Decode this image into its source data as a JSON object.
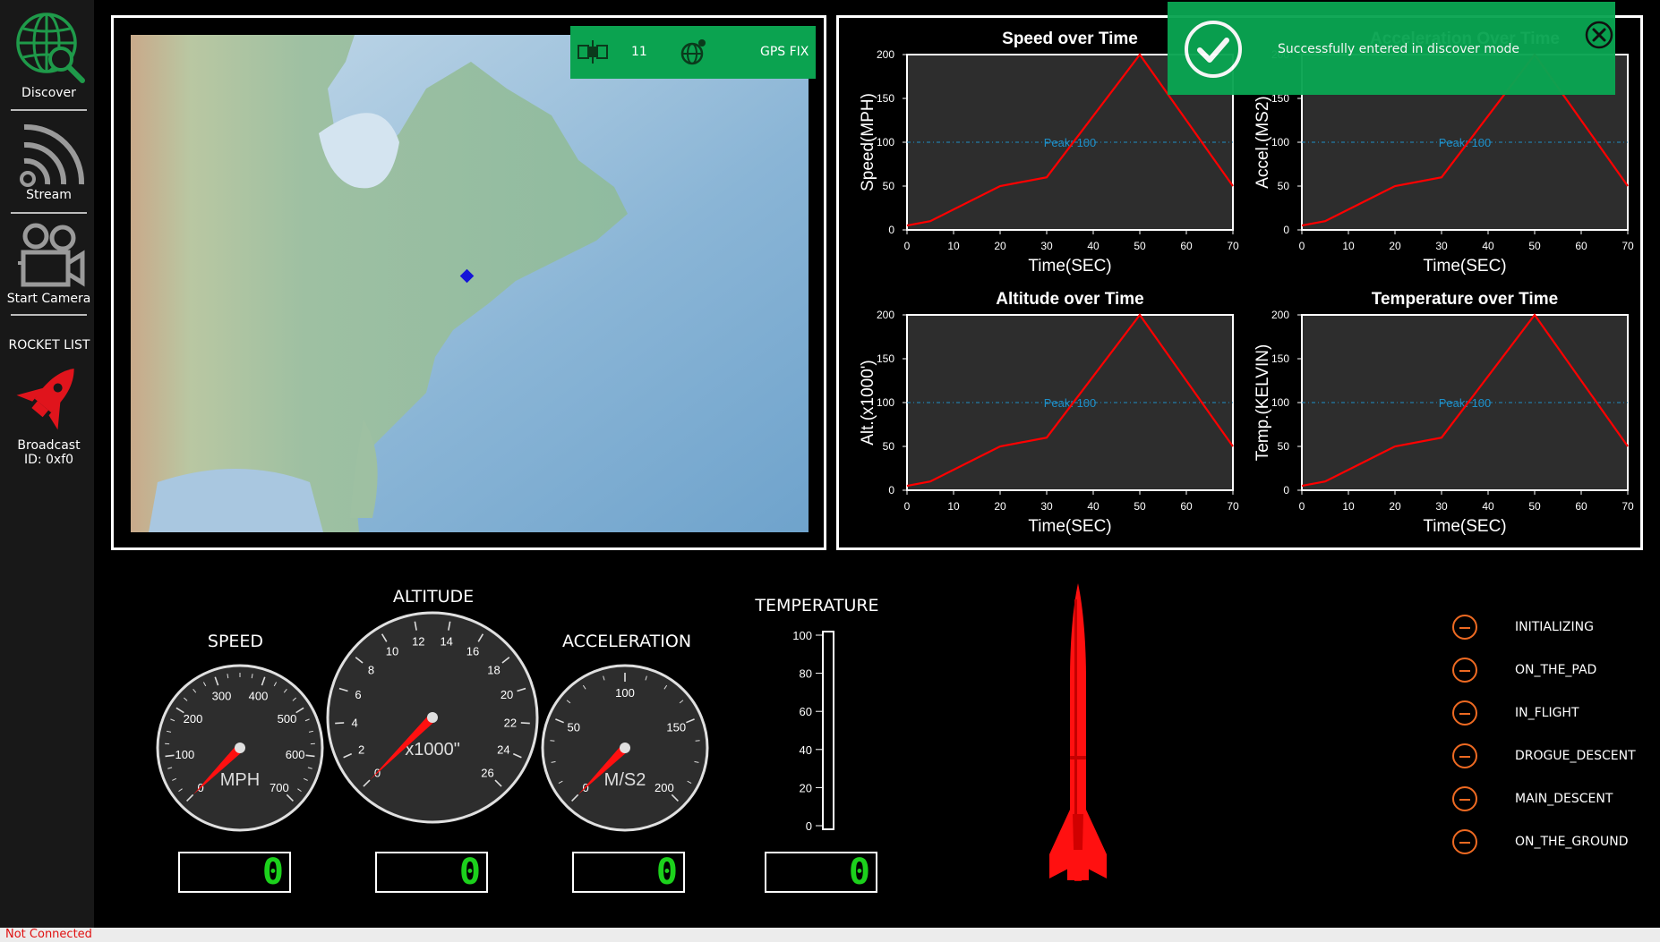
{
  "sidebar": {
    "discover_label": "Discover",
    "stream_label": "Stream",
    "camera_label": "Start Camera",
    "rocket_list_title": "ROCKET LIST",
    "rocket_item_label": "Broadcast",
    "rocket_item_id": "ID: 0xf0",
    "icons": [
      "globe-search-icon",
      "wifi-stream-icon",
      "camera-icon",
      "rocket-icon"
    ]
  },
  "gps": {
    "satellite_count": "11",
    "fix_label": "GPS FIX",
    "icons": [
      "satellite-icon",
      "gps-globe-icon"
    ]
  },
  "toast": {
    "message": "Successfully entered in discover mode",
    "color": "#0aa552",
    "icons": [
      "check-circle-icon",
      "close-circle-icon"
    ]
  },
  "chart_data": [
    {
      "type": "line",
      "title": "Speed over Time",
      "xlabel": "Time(SEC)",
      "ylabel": "Speed(MPH)",
      "x": [
        0,
        5,
        20,
        30,
        50,
        70
      ],
      "series": [
        {
          "values": [
            5,
            10,
            50,
            60,
            200,
            50
          ],
          "color": "#ff0000"
        }
      ],
      "reference_line": {
        "value": 100,
        "label": "Peak: 100",
        "color": "#1e8fc8"
      },
      "xlim": [
        0,
        70
      ],
      "ylim": [
        0,
        200
      ],
      "xticks": [
        "0",
        "10",
        "20",
        "30",
        "40",
        "50",
        "60",
        "70"
      ],
      "yticks": [
        "0",
        "50",
        "100",
        "150",
        "200"
      ],
      "background": "#2d2d2d"
    },
    {
      "type": "line",
      "title": "Acceleration Over Time",
      "xlabel": "Time(SEC)",
      "ylabel": "Accel.(MS2)",
      "x": [
        0,
        5,
        20,
        30,
        50,
        70
      ],
      "series": [
        {
          "values": [
            5,
            10,
            50,
            60,
            200,
            50
          ],
          "color": "#ff0000"
        }
      ],
      "reference_line": {
        "value": 100,
        "label": "Peak: 100",
        "color": "#1e8fc8"
      },
      "xlim": [
        0,
        70
      ],
      "ylim": [
        0,
        200
      ],
      "xticks": [
        "0",
        "10",
        "20",
        "30",
        "40",
        "50",
        "60",
        "70"
      ],
      "yticks": [
        "0",
        "50",
        "100",
        "150",
        "200"
      ],
      "background": "#2d2d2d"
    },
    {
      "type": "line",
      "title": "Altitude over Time",
      "xlabel": "Time(SEC)",
      "ylabel": "Alt.(x1000')",
      "x": [
        0,
        5,
        20,
        30,
        50,
        70
      ],
      "series": [
        {
          "values": [
            5,
            10,
            50,
            60,
            200,
            50
          ],
          "color": "#ff0000"
        }
      ],
      "reference_line": {
        "value": 100,
        "label": "Peak: 100",
        "color": "#1e8fc8"
      },
      "xlim": [
        0,
        70
      ],
      "ylim": [
        0,
        200
      ],
      "xticks": [
        "0",
        "10",
        "20",
        "30",
        "40",
        "50",
        "60",
        "70"
      ],
      "yticks": [
        "0",
        "50",
        "100",
        "150",
        "200"
      ],
      "background": "#2d2d2d"
    },
    {
      "type": "line",
      "title": "Temperature over Time",
      "xlabel": "Time(SEC)",
      "ylabel": "Temp.(KELVIN)",
      "x": [
        0,
        5,
        20,
        30,
        50,
        70
      ],
      "series": [
        {
          "values": [
            5,
            10,
            50,
            60,
            200,
            50
          ],
          "color": "#ff0000"
        }
      ],
      "reference_line": {
        "value": 100,
        "label": "Peak: 100",
        "color": "#1e8fc8"
      },
      "xlim": [
        0,
        70
      ],
      "ylim": [
        0,
        200
      ],
      "xticks": [
        "0",
        "10",
        "20",
        "30",
        "40",
        "50",
        "60",
        "70"
      ],
      "yticks": [
        "0",
        "50",
        "100",
        "150",
        "200"
      ],
      "background": "#2d2d2d"
    }
  ],
  "gauges": [
    {
      "id": "speed",
      "title": "SPEED",
      "unit": "MPH",
      "ticks": [
        "0",
        "100",
        "200",
        "300",
        "400",
        "500",
        "600",
        "700"
      ],
      "value": 0,
      "display": "0"
    },
    {
      "id": "altitude",
      "title": "ALTITUDE",
      "unit": "x1000\"",
      "ticks": [
        "0",
        "2",
        "4",
        "6",
        "8",
        "10",
        "12",
        "14",
        "16",
        "18",
        "20",
        "22",
        "24",
        "26"
      ],
      "value": 0,
      "display": "0"
    },
    {
      "id": "acceleration",
      "title": "ACCELERATION",
      "unit": "M/S2",
      "ticks": [
        "0",
        "50",
        "100",
        "150",
        "200"
      ],
      "value": 0,
      "display": "0"
    }
  ],
  "temperature": {
    "title": "TEMPERATURE",
    "ticks": [
      "0",
      "20",
      "40",
      "60",
      "80",
      "100"
    ],
    "value": 0,
    "display": "0"
  },
  "status_states": [
    "INITIALIZING",
    "ON_THE_PAD",
    "IN_FLIGHT",
    "DROGUE_DESCENT",
    "MAIN_DESCENT",
    "ON_THE_GROUND"
  ],
  "connection_status": "Not Connected",
  "colors": {
    "accent_green": "#0ba350",
    "rocket_red": "#ff0000",
    "status_orange": "#ee6a22",
    "lcd_green": "#1cd11c",
    "error_red": "#e01010"
  }
}
